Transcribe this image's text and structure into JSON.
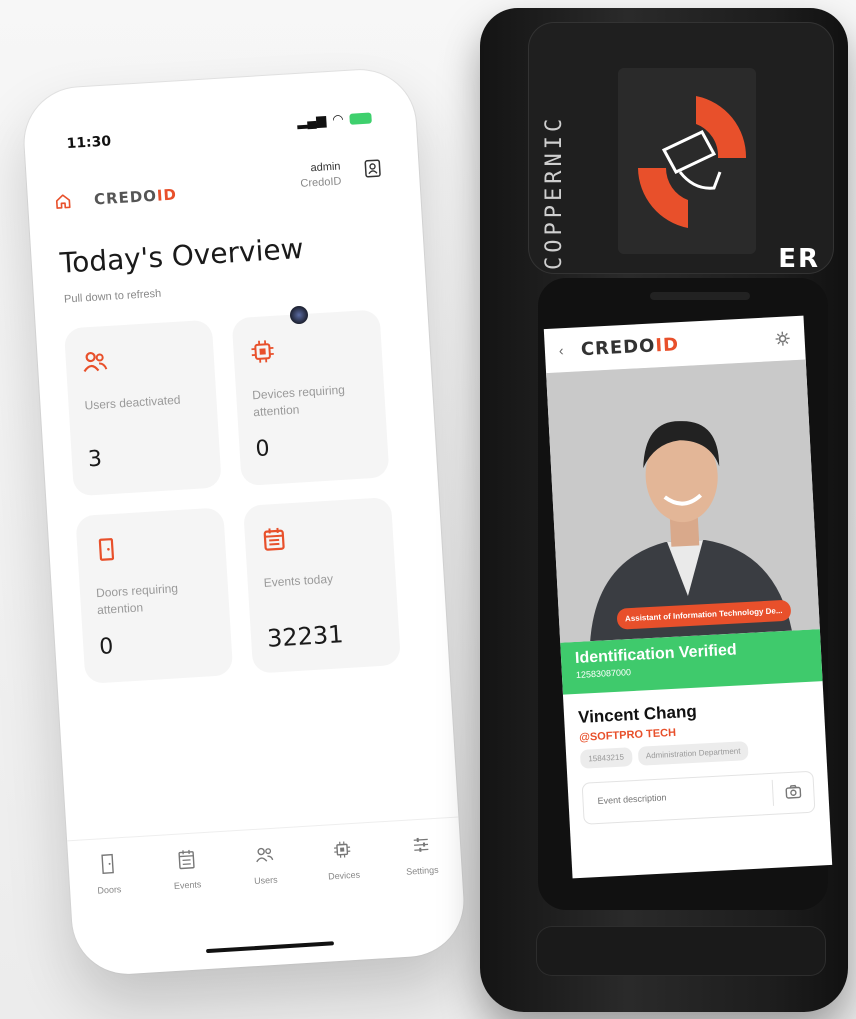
{
  "phone": {
    "time": "11:30",
    "logo": {
      "main": "CREDO",
      "accent": "ID"
    },
    "user": {
      "name": "admin",
      "org": "CredoID"
    },
    "title": "Today's Overview",
    "subtitle": "Pull down to refresh",
    "cards": [
      {
        "label": "Users deactivated",
        "value": "3",
        "icon": "users-icon"
      },
      {
        "label": "Devices requiring attention",
        "value": "0",
        "icon": "chip-icon"
      },
      {
        "label": "Doors requiring attention",
        "value": "0",
        "icon": "door-icon"
      },
      {
        "label": "Events today",
        "value": "32231",
        "icon": "calendar-icon"
      }
    ],
    "nav": [
      {
        "label": "Doors",
        "icon": "door-icon"
      },
      {
        "label": "Events",
        "icon": "events-icon"
      },
      {
        "label": "Users",
        "icon": "users-icon"
      },
      {
        "label": "Devices",
        "icon": "chip-icon"
      },
      {
        "label": "Settings",
        "icon": "sliders-icon"
      }
    ]
  },
  "device": {
    "brand": "COPPERNIC",
    "model_logo": "ER",
    "screen": {
      "back": "‹",
      "logo": {
        "main": "CREDO",
        "accent": "ID"
      },
      "role": "Assistant of Information Technology De...",
      "verified_title": "Identification Verified",
      "verified_number": "12583087000",
      "name": "Vincent Chang",
      "company": "@SOFTPRO TECH",
      "chips": [
        "15843215",
        "Administration Department"
      ],
      "description_placeholder": "Event description"
    }
  },
  "colors": {
    "accent": "#e8502b",
    "verified": "#3fca6c"
  }
}
